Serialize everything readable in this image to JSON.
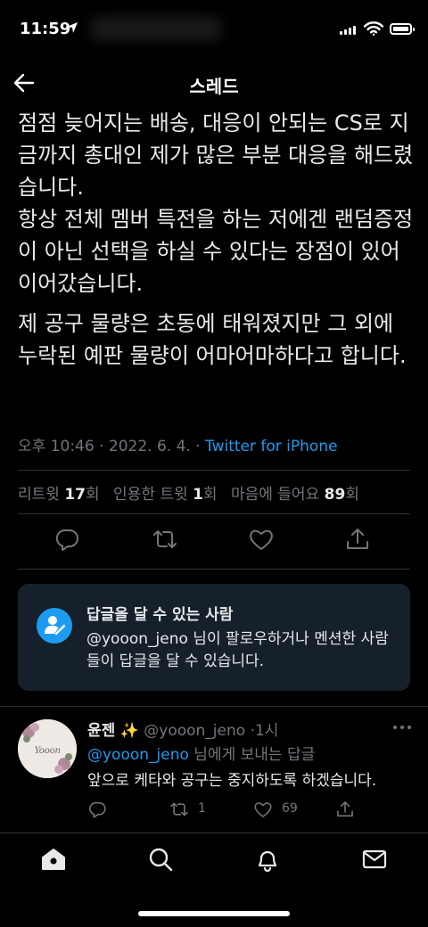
{
  "status_bar": {
    "time": "11:59"
  },
  "header": {
    "title": "스레드"
  },
  "tweet": {
    "paragraph1": "점점 늦어지는 배송, 대응이 안되는 CS로 지금까지 총대인 제가 많은 부분 대응을 해드렸습니다.\n항상 전체 멤버 특전을 하는 저에겐 랜덤증정이 아닌 선택을 하실 수 있다는 장점이 있어 이어갔습니다.",
    "paragraph2": "제 공구 물량은 초동에 태워졌지만 그 외에 누락된 예판 물량이 어마어마하다고 합니다.",
    "timestamp": "오후 10:46 · 2022. 6. 4. · ",
    "source": "Twitter for iPhone",
    "retweets_label": "리트윗",
    "retweets_count": "17",
    "retweets_unit": "회",
    "quotes_label": "인용한 트윗",
    "quotes_count": "1",
    "quotes_unit": "회",
    "likes_label": "마음에 들어요",
    "likes_count": "89",
    "likes_unit": "회"
  },
  "reply_restriction": {
    "title": "답글을 달 수 있는 사람",
    "body": "@yooon_jeno 님이 팔로우하거나 멘션한 사람들이 답글을 달 수 있습니다."
  },
  "reply": {
    "name": "윤젠",
    "sparkle": "✨",
    "handle": "@yooon_jeno",
    "time": "·1시",
    "mention": "@yooon_jeno",
    "to_suffix": " 님에게 보내는 답글",
    "text": "앞으로 케타와 공구는 중지하도록 하겠습니다.",
    "retweet_count": "1",
    "like_count": "69",
    "avatar_text": "Yooon"
  },
  "icons": {
    "comment": "comment-icon",
    "retweet": "retweet-icon",
    "like": "heart-icon",
    "share": "share-icon",
    "home": "home-icon",
    "search": "search-icon",
    "notifications": "bell-icon",
    "messages": "mail-icon"
  },
  "colors": {
    "background": "#000000",
    "accent": "#1d9bf0",
    "muted_text": "#71767b",
    "card_background": "#15202b"
  }
}
